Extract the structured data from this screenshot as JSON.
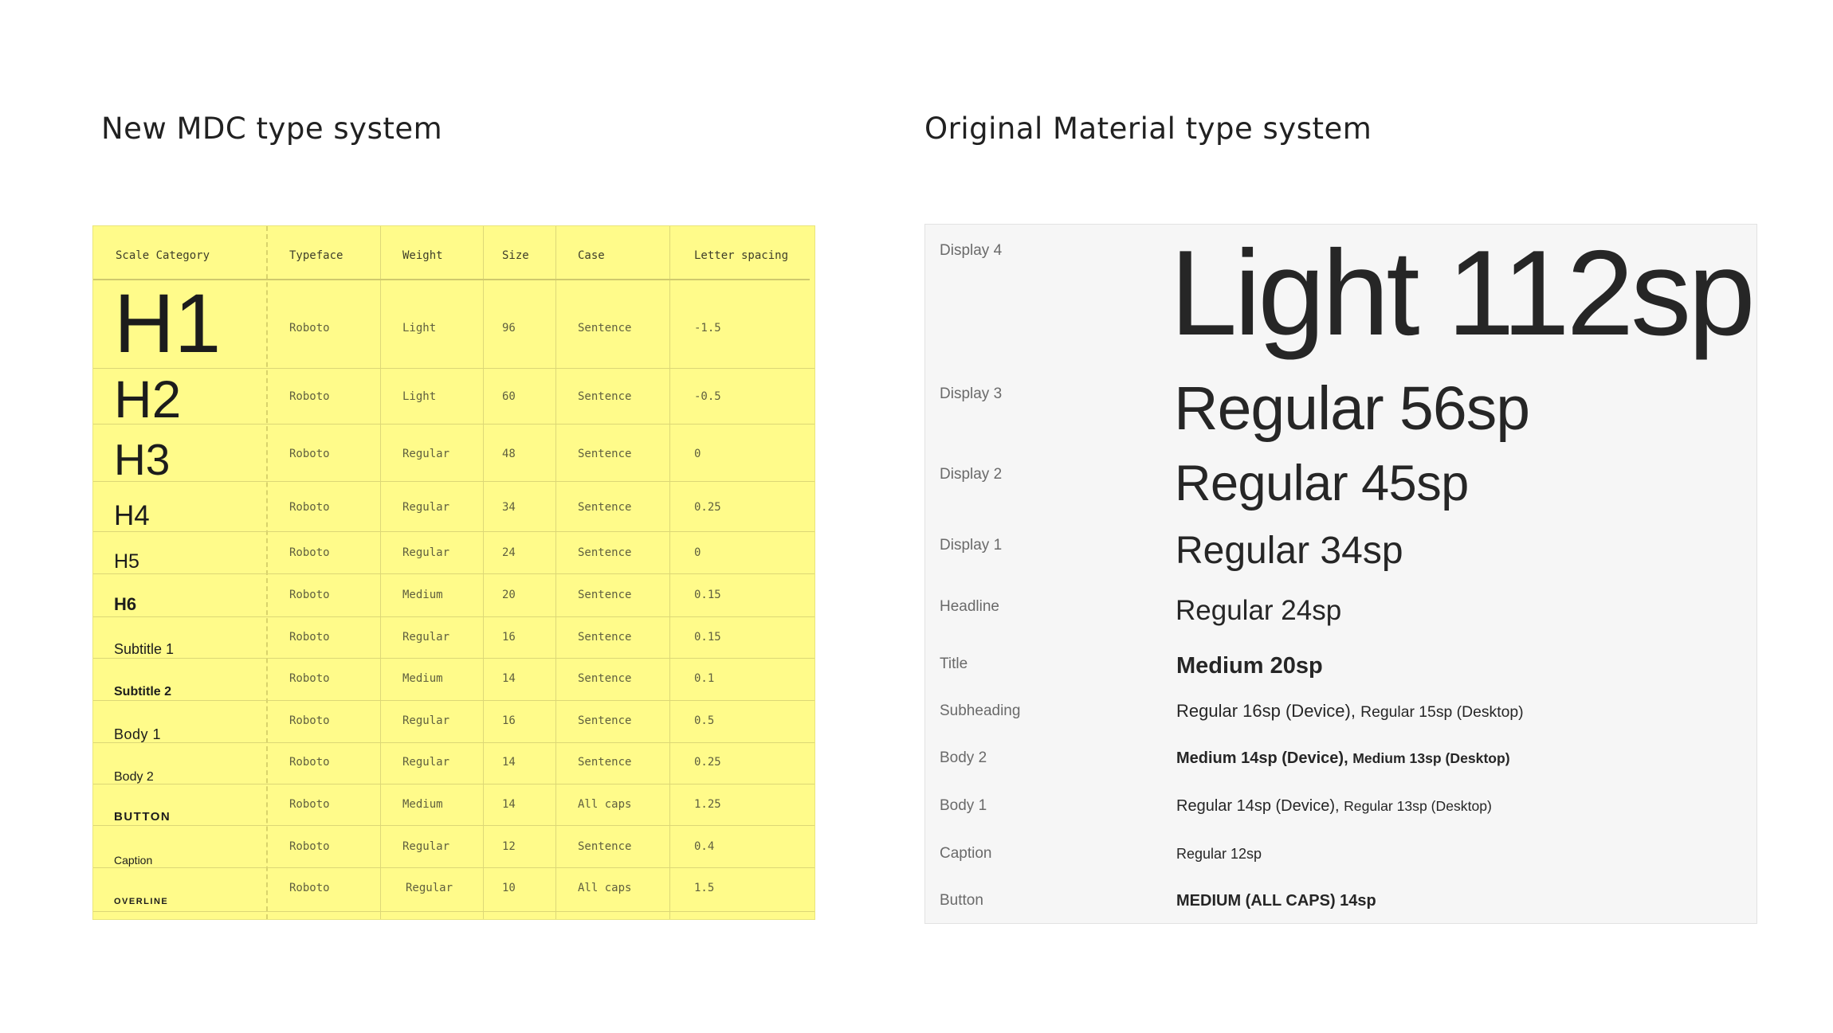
{
  "left_title": "New MDC type system",
  "right_title": "Original Material type system",
  "mdc_table": {
    "headers": [
      "Scale Category",
      "Typeface",
      "Weight",
      "Size",
      "Case",
      "Letter spacing"
    ],
    "rows": [
      {
        "category": "H1",
        "typeface": "Roboto",
        "weight": "Light",
        "size": "96",
        "case": "Sentence",
        "spacing": "-1.5"
      },
      {
        "category": "H2",
        "typeface": "Roboto",
        "weight": "Light",
        "size": "60",
        "case": "Sentence",
        "spacing": "-0.5"
      },
      {
        "category": "H3",
        "typeface": "Roboto",
        "weight": "Regular",
        "size": "48",
        "case": "Sentence",
        "spacing": "0"
      },
      {
        "category": "H4",
        "typeface": "Roboto",
        "weight": "Regular",
        "size": "34",
        "case": "Sentence",
        "spacing": "0.25"
      },
      {
        "category": "H5",
        "typeface": "Roboto",
        "weight": "Regular",
        "size": "24",
        "case": "Sentence",
        "spacing": "0"
      },
      {
        "category": "H6",
        "typeface": "Roboto",
        "weight": "Medium",
        "size": "20",
        "case": "Sentence",
        "spacing": "0.15"
      },
      {
        "category": "Subtitle 1",
        "typeface": "Roboto",
        "weight": "Regular",
        "size": "16",
        "case": "Sentence",
        "spacing": "0.15"
      },
      {
        "category": "Subtitle 2",
        "typeface": "Roboto",
        "weight": "Medium",
        "size": "14",
        "case": "Sentence",
        "spacing": "0.1"
      },
      {
        "category": "Body 1",
        "typeface": "Roboto",
        "weight": "Regular",
        "size": "16",
        "case": "Sentence",
        "spacing": "0.5"
      },
      {
        "category": "Body 2",
        "typeface": "Roboto",
        "weight": "Regular",
        "size": "14",
        "case": "Sentence",
        "spacing": "0.25"
      },
      {
        "category": "BUTTON",
        "typeface": "Roboto",
        "weight": "Medium",
        "size": "14",
        "case": "All caps",
        "spacing": "1.25"
      },
      {
        "category": "Caption",
        "typeface": "Roboto",
        "weight": "Regular",
        "size": "12",
        "case": "Sentence",
        "spacing": "0.4"
      },
      {
        "category": "OVERLINE",
        "typeface": "Roboto",
        "weight": "Regular",
        "size": "10",
        "case": "All caps",
        "spacing": "1.5"
      }
    ]
  },
  "material_scale": [
    {
      "label": "Display 4",
      "sample": "Light 112sp"
    },
    {
      "label": "Display 3",
      "sample": "Regular 56sp"
    },
    {
      "label": "Display 2",
      "sample": "Regular 45sp"
    },
    {
      "label": "Display 1",
      "sample": "Regular 34sp"
    },
    {
      "label": "Headline",
      "sample": "Regular 24sp"
    },
    {
      "label": "Title",
      "sample": "Medium 20sp"
    },
    {
      "label": "Subheading",
      "sample": "Regular 16sp (Device),",
      "sample_b": "Regular 15sp (Desktop)"
    },
    {
      "label": "Body 2",
      "sample": "Medium 14sp (Device),",
      "sample_b": "Medium 13sp (Desktop)"
    },
    {
      "label": "Body 1",
      "sample": "Regular 14sp (Device),",
      "sample_b": "Regular 13sp (Desktop)"
    },
    {
      "label": "Caption",
      "sample": "Regular 12sp"
    },
    {
      "label": "Button",
      "sample": "MEDIUM (ALL CAPS) 14sp"
    }
  ],
  "colors": {
    "table_bg": "#fffb8a",
    "panel_bg": "#f6f6f6",
    "text": "#212121"
  }
}
